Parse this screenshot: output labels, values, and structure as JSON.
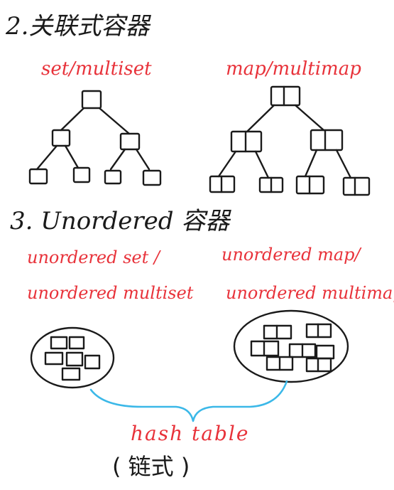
{
  "sections": {
    "associative_heading": "2.关联式容器",
    "unordered_heading": "3. Unordered 容器"
  },
  "labels": {
    "set_multiset": "set/multiset",
    "map_multimap": "map/multimap",
    "unordered_set": "unordered set /",
    "unordered_multiset": "unordered multiset",
    "unordered_map": "unordered map/",
    "unordered_multimap": "unordered multimap",
    "hash_table": "hash table",
    "chain_style": "( 链式 )"
  },
  "colors": {
    "ink": "#1a1a1a",
    "red": "#e8323a",
    "bracket_blue": "#3bb8e8"
  }
}
